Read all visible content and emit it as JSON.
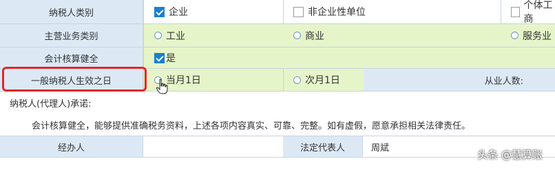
{
  "rows": {
    "taxpayer_type": {
      "label": "纳税人类别",
      "options": [
        {
          "text": "企业",
          "checked": true
        },
        {
          "text": "非企业性单位",
          "checked": false
        },
        {
          "text": "个体工商",
          "checked": false
        }
      ]
    },
    "business_category": {
      "label": "主营业务类别",
      "options": [
        "工业",
        "商业",
        "服务业"
      ]
    },
    "accounting": {
      "label": "会计核算健全",
      "option": {
        "text": "是",
        "checked": true
      }
    },
    "effective_date": {
      "label": "一般纳税人生效之日",
      "options": [
        "当月1日",
        "次月1日"
      ],
      "employees_label": "从业人数:"
    }
  },
  "commitment": {
    "title": "纳税人(代理人)承诺:",
    "text": "会计核算健全，能够提供准确税务资料，上述各项内容真实、可靠、完整。如有虚假，愿意承担相关法律责任。"
  },
  "signatures": {
    "handler_label": "经办人",
    "handler_value": "",
    "legal_rep_label": "法定代表人",
    "legal_rep_value": "周斌"
  },
  "watermark": "头条 @慧算账",
  "colors": {
    "label_bg": "#dce9f5",
    "option_bg": "#e6f5c9",
    "highlight_border": "#e0282a",
    "check_blue": "#1a7fd1"
  }
}
